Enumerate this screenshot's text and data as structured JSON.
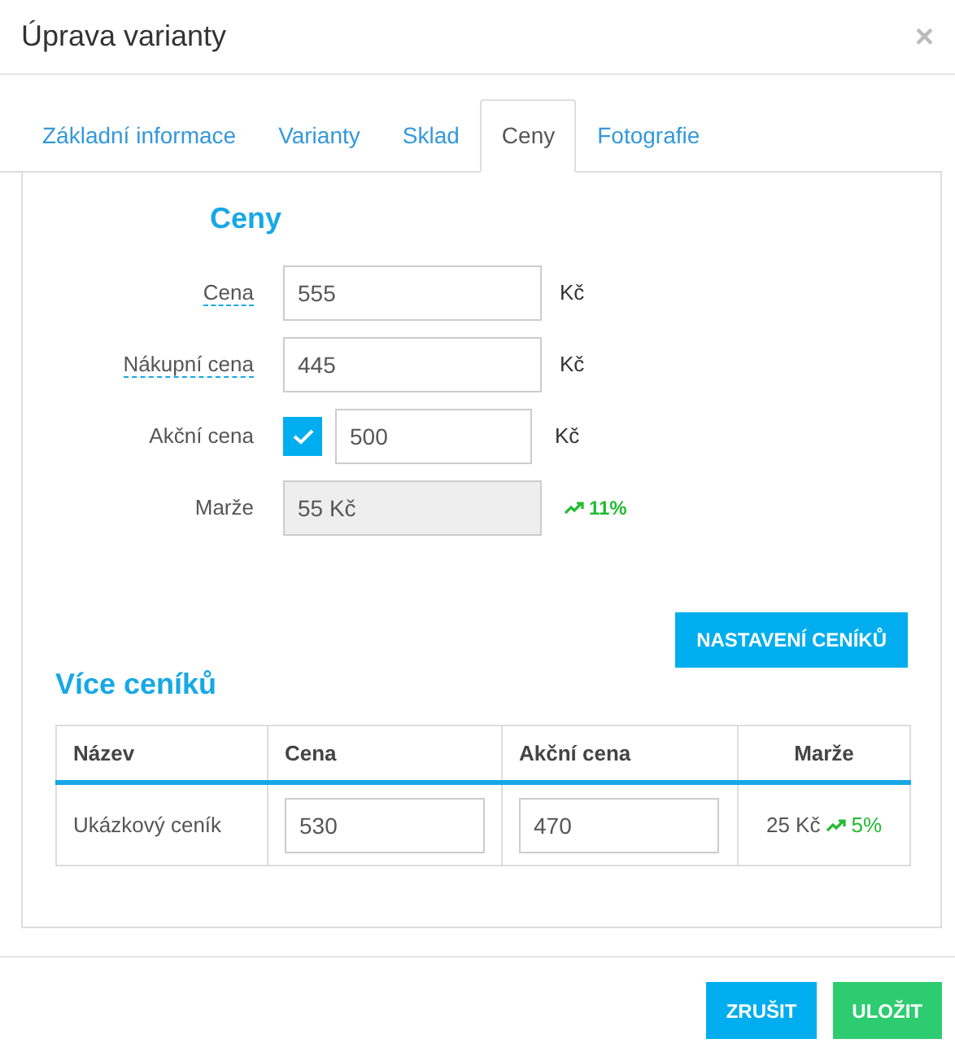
{
  "window": {
    "title": "Úprava varianty",
    "close": "×"
  },
  "tabs": [
    {
      "label": "Základní informace",
      "selected": false
    },
    {
      "label": "Varianty",
      "selected": false
    },
    {
      "label": "Sklad",
      "selected": false
    },
    {
      "label": "Ceny",
      "selected": true
    },
    {
      "label": "Fotografie",
      "selected": false
    }
  ],
  "prices": {
    "heading": "Ceny",
    "fields": [
      {
        "kind": "input",
        "label": "Cena",
        "hint": true,
        "value": "555",
        "unit": "Kč"
      },
      {
        "kind": "input",
        "label": "Nákupní cena",
        "hint": true,
        "value": "445",
        "unit": "Kč"
      },
      {
        "kind": "checked-input",
        "label": "Akční cena",
        "hint": false,
        "checked": true,
        "value": "500",
        "unit": "Kč"
      },
      {
        "kind": "readonly",
        "label": "Marže",
        "hint": false,
        "value": "55 Kč",
        "trend": "11%"
      }
    ]
  },
  "pricelist_button": "NASTAVENÍ CENÍKŮ",
  "pricelists": {
    "heading": "Více ceníků",
    "columns": [
      "Název",
      "Cena",
      "Akční cena",
      "Marže"
    ],
    "rows": [
      {
        "name": "Ukázkový ceník",
        "price": "530",
        "action_price": "470",
        "margin": "25 Kč",
        "trend": "5%"
      }
    ]
  },
  "buttons": [
    {
      "kind": "cancel",
      "label": "ZRUŠIT"
    },
    {
      "kind": "save",
      "label": "ULOŽIT"
    }
  ]
}
